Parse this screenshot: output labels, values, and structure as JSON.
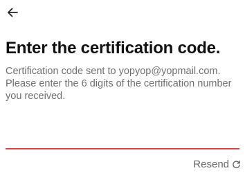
{
  "header": {
    "back_icon": "arrow-left-icon"
  },
  "main": {
    "title": "Enter the certification code.",
    "description_lines": [
      "Certification code sent to yopyop@yopmail.com.",
      "Please enter the 6 digits of the certification number",
      "you received."
    ],
    "code_input": {
      "value": "",
      "placeholder": ""
    },
    "resend": {
      "label": "Resend",
      "icon": "refresh-icon"
    }
  },
  "colors": {
    "accent": "#d64541",
    "title": "#111111",
    "description": "#6f6f6f",
    "resend": "#666666"
  }
}
